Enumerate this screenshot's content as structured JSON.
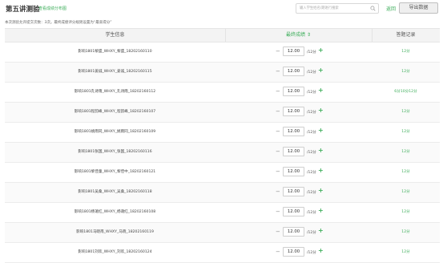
{
  "header": {
    "title": "第五讲测验",
    "view_distribution": "查看成绩分布图",
    "search_placeholder": "输入学生姓名/期进行搜索",
    "back_label": "返回",
    "export_label": "导出数据"
  },
  "note": "本次测验允许提交次数：3次。最终成绩评分规则设置为“最高得分”",
  "table": {
    "headers": {
      "name": "学生信息",
      "score": "最终成绩 ⇕",
      "record": "答题记录"
    },
    "rows": [
      {
        "name": "影响1801黎盛_WHXY_黎盛_18202160110",
        "score": "12.00",
        "total": "/12分",
        "record": "12分"
      },
      {
        "name": "影响1801姜诚_WHXY_姜诚_18202160115",
        "score": "12.00",
        "total": "/12分",
        "record": "12分"
      },
      {
        "name": "影响1801孔诗雨_WHXY_孔诗雨_18202160112",
        "score": "12.00",
        "total": "/12分",
        "record": "6分10分12分"
      },
      {
        "name": "影响1801程韵峰_WHXY_程韵峰_18202160107",
        "score": "12.00",
        "total": "/12分",
        "record": "12分"
      },
      {
        "name": "影响1801姚雨同_WHXY_姚雨同_18202160109",
        "score": "12.00",
        "total": "/12分",
        "record": "12分"
      },
      {
        "name": "影响1801张国_WHXY_张国_18202160116",
        "score": "12.00",
        "total": "/12分",
        "record": "12分"
      },
      {
        "name": "影响1801黎佳童_WHXY_黎佳中_18202160121",
        "score": "12.00",
        "total": "/12分",
        "record": "12分"
      },
      {
        "name": "影响1801吴桑_WHXY_吴桑_18202160118",
        "score": "12.00",
        "total": "/12分",
        "record": "12分"
      },
      {
        "name": "影响1801杨蔼红_WHXY_杨蔼红_18202160108",
        "score": "12.00",
        "total": "/12分",
        "record": "12分"
      },
      {
        "name": "影响1801马晓南_WHXY_马晓_18202160119",
        "score": "12.00",
        "total": "/12分",
        "record": "12分"
      },
      {
        "name": "影响1801刘欢_WHXY_刘欢_18202160124",
        "score": "12.00",
        "total": "/12分",
        "record": "12分"
      }
    ]
  },
  "colors": {
    "accent": "#3eae5b",
    "header_bg": "#f3f3f3"
  }
}
